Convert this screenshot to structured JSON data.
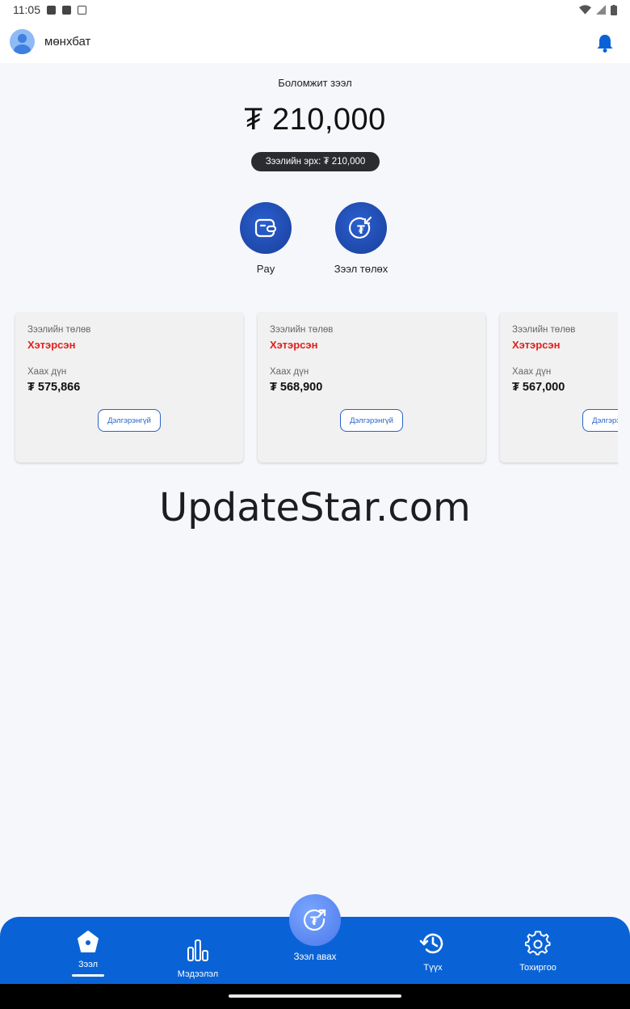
{
  "status_bar": {
    "time": "11:05"
  },
  "header": {
    "username": "мөнхбат"
  },
  "balance": {
    "label": "Боломжит зээл",
    "amount": "₮ 210,000",
    "limit_text": "Зээлийн эрх: ₮ 210,000"
  },
  "actions": [
    {
      "label": "Pay",
      "icon": "wallet-icon"
    },
    {
      "label": "Зээл төлөх",
      "icon": "tugrik-return-icon"
    }
  ],
  "cards": [
    {
      "status_title": "Зээлийн төлөв",
      "status": "Хэтэрсэн",
      "amount_title": "Хаах дүн",
      "amount": "₮ 575,866",
      "button": "Дэлгэрэнгүй"
    },
    {
      "status_title": "Зээлийн төлөв",
      "status": "Хэтэрсэн",
      "amount_title": "Хаах дүн",
      "amount": "₮ 568,900",
      "button": "Дэлгэрэнгүй"
    },
    {
      "status_title": "Зээлийн төлөв",
      "status": "Хэтэрсэн",
      "amount_title": "Хаах дүн",
      "amount": "₮ 567,000",
      "button": "Дэлгэрэнгүй"
    }
  ],
  "watermark": "UpdateStar.com",
  "bottom_nav": {
    "items": [
      {
        "label": "Зээл",
        "icon": "home-icon",
        "active": true
      },
      {
        "label": "Мэдээлэл",
        "icon": "bar-chart-icon"
      },
      {
        "label": "Түүх",
        "icon": "history-icon"
      },
      {
        "label": "Тохиргоо",
        "icon": "settings-icon"
      }
    ],
    "fab_label": "Зээл авах"
  },
  "colors": {
    "primary": "#0a63d6",
    "overdue": "#e0201b",
    "pill": "#2b2c30"
  }
}
